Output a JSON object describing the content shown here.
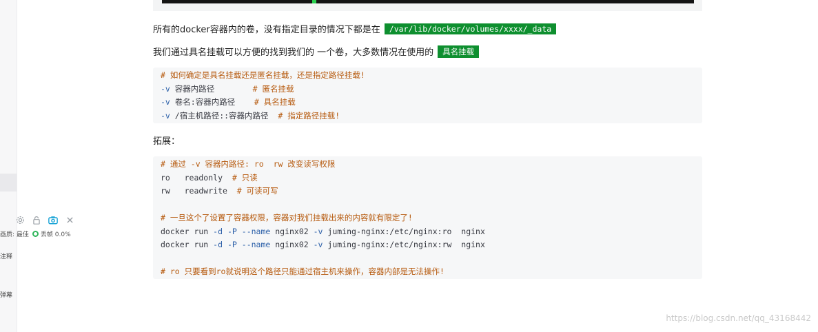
{
  "sidebar": {
    "status_quality": "画质: 最佳",
    "status_frames": "丢帧 0.0%",
    "label_comment": "注释",
    "label_bullet": "弹幕"
  },
  "article": {
    "para1_text": "所有的docker容器内的卷，没有指定目录的情况下都是在",
    "para1_highlight": "/var/lib/docker/volumes/xxxx/_data",
    "para2_text": "我们通过具名挂载可以方便的找到我们的 一个卷，大多数情况在使用的",
    "para2_highlight": "具名挂载",
    "heading_extend": "拓展：",
    "code1": [
      {
        "parts": [
          {
            "t": "# 如何确定是具名挂载还是匿名挂载，还是指定路径挂载!",
            "c": "comment"
          }
        ]
      },
      {
        "parts": [
          {
            "t": "-v",
            "c": "flag"
          },
          {
            "t": " 容器内路径        ",
            "c": "plain"
          },
          {
            "t": "# 匿名挂载",
            "c": "comment"
          }
        ]
      },
      {
        "parts": [
          {
            "t": "-v",
            "c": "flag"
          },
          {
            "t": " 卷名:容器内路径    ",
            "c": "plain"
          },
          {
            "t": "# 具名挂载",
            "c": "comment"
          }
        ]
      },
      {
        "parts": [
          {
            "t": "-v",
            "c": "flag"
          },
          {
            "t": " /宿主机路径::容器内路径  ",
            "c": "plain"
          },
          {
            "t": "# 指定路径挂载!",
            "c": "comment"
          }
        ]
      }
    ],
    "code2": [
      {
        "parts": [
          {
            "t": "# 通过 -v 容器内路径: ro  rw 改变读写权限",
            "c": "comment"
          }
        ]
      },
      {
        "parts": [
          {
            "t": "ro   readonly  ",
            "c": "plain"
          },
          {
            "t": "# 只读",
            "c": "comment"
          }
        ]
      },
      {
        "parts": [
          {
            "t": "rw   readwrite  ",
            "c": "plain"
          },
          {
            "t": "# 可读可写",
            "c": "comment"
          }
        ]
      },
      {
        "parts": [
          {
            "t": "",
            "c": "plain"
          }
        ]
      },
      {
        "parts": [
          {
            "t": "# 一旦这个了设置了容器权限，容器对我们挂载出来的内容就有限定了!",
            "c": "comment"
          }
        ]
      },
      {
        "parts": [
          {
            "t": "docker run ",
            "c": "plain"
          },
          {
            "t": "-d",
            "c": "flag"
          },
          {
            "t": " ",
            "c": "plain"
          },
          {
            "t": "-P",
            "c": "flag"
          },
          {
            "t": " ",
            "c": "plain"
          },
          {
            "t": "--name",
            "c": "flag"
          },
          {
            "t": " nginx02 ",
            "c": "plain"
          },
          {
            "t": "-v",
            "c": "flag"
          },
          {
            "t": " juming-nginx:/etc/nginx:ro  nginx",
            "c": "plain"
          }
        ]
      },
      {
        "parts": [
          {
            "t": "docker run ",
            "c": "plain"
          },
          {
            "t": "-d",
            "c": "flag"
          },
          {
            "t": " ",
            "c": "plain"
          },
          {
            "t": "-P",
            "c": "flag"
          },
          {
            "t": " ",
            "c": "plain"
          },
          {
            "t": "--name",
            "c": "flag"
          },
          {
            "t": " nginx02 ",
            "c": "plain"
          },
          {
            "t": "-v",
            "c": "flag"
          },
          {
            "t": " juming-nginx:/etc/nginx:rw  nginx",
            "c": "plain"
          }
        ]
      },
      {
        "parts": [
          {
            "t": "",
            "c": "plain"
          }
        ]
      },
      {
        "parts": [
          {
            "t": "# ro 只要看到ro就说明这个路径只能通过宿主机来操作，容器内部是无法操作!",
            "c": "comment"
          }
        ]
      }
    ]
  },
  "watermark": "https://blog.csdn.net/qq_43168442",
  "icons": [
    "gear-icon",
    "lock-icon",
    "screenshot-icon",
    "close-icon"
  ],
  "colors": {
    "highlight_bg": "#0e8f2f",
    "comment": "#b65a0e",
    "flag": "#2b5fa8",
    "code_bg": "#f6f7f8"
  }
}
